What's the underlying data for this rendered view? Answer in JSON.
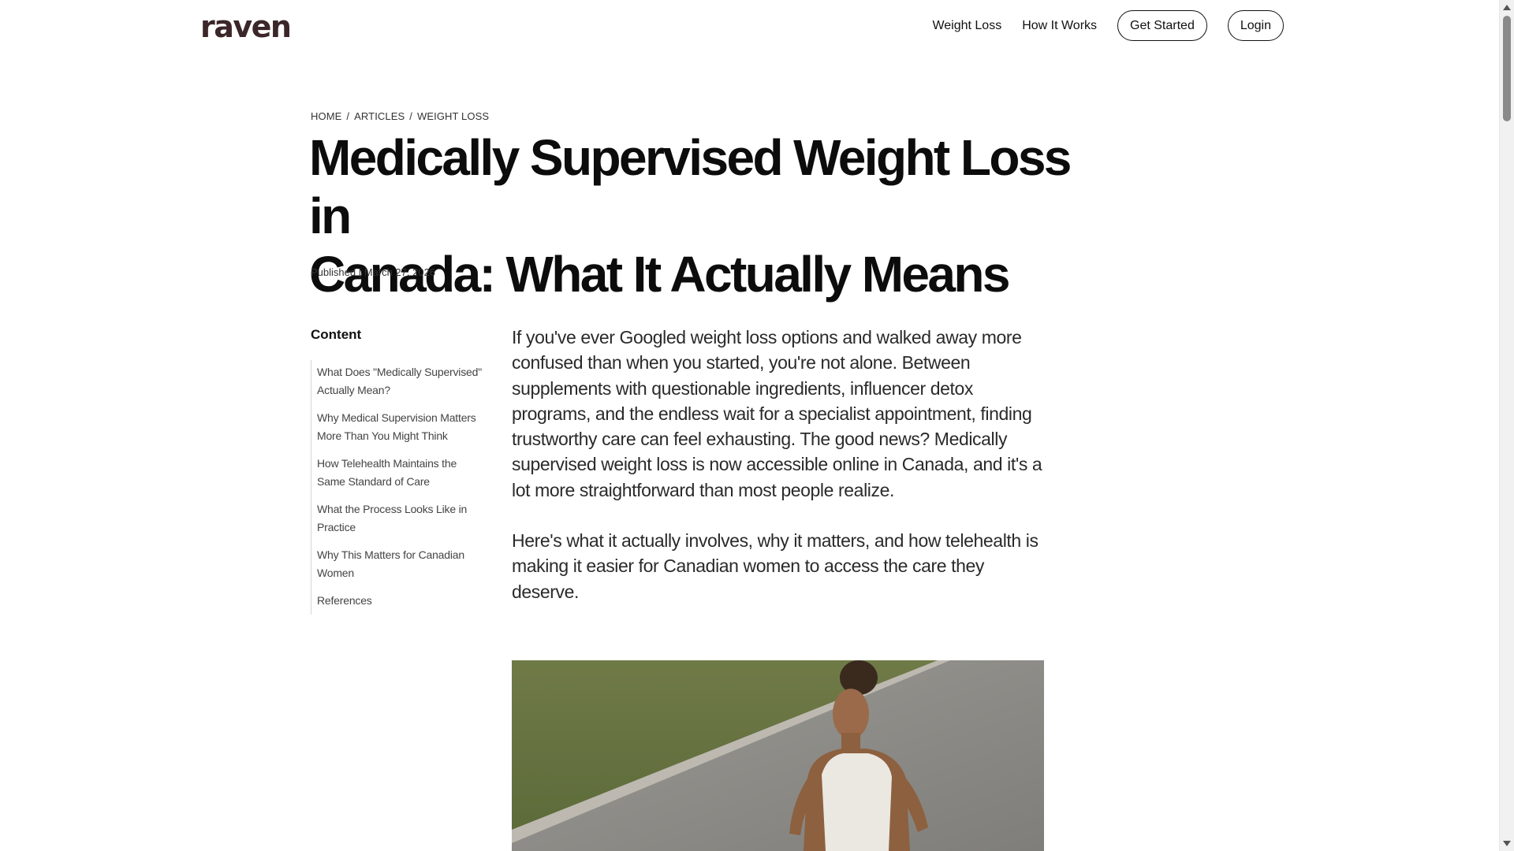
{
  "brand": {
    "logo_text": "raven",
    "logo_color": "#3b2629"
  },
  "nav": {
    "links": [
      "Weight Loss",
      "How It Works"
    ],
    "cta_label": "Get Started",
    "login_label": "Login"
  },
  "breadcrumb": [
    "HOME",
    "ARTICLES",
    "WEIGHT LOSS"
  ],
  "breadcrumb_separator": "/",
  "article": {
    "title_line1": "Medically Supervised Weight Loss in",
    "title_line2": "Canada: What It Actually Means",
    "published": "Published | March 27, 2026",
    "paragraphs": [
      "If you've ever Googled weight loss options and walked away more confused than when you started, you're not alone. Between supplements with questionable ingredients, influencer detox programs, and the endless wait for a specialist appointment, finding trustworthy care can feel exhausting. The good news? Medically supervised weight loss is now accessible online in Canada, and it's a lot more straightforward than most people realize.",
      "Here's what it actually involves, why it matters, and how telehealth is making it easier for Canadian women to access the care they deserve."
    ]
  },
  "toc": {
    "heading": "Content",
    "items": [
      "What Does \"Medically Supervised\" Actually Mean?",
      "Why Medical Supervision Matters More Than You Might Think",
      "How Telehealth Maintains the Same Standard of Care",
      "What the Process Looks Like in Practice",
      "Why This Matters for Canadian Women",
      "References"
    ]
  },
  "colors": {
    "text": "#111111",
    "body_text": "#2a2a2a",
    "muted": "#444444",
    "toc_rule": "#d6d6d6"
  }
}
